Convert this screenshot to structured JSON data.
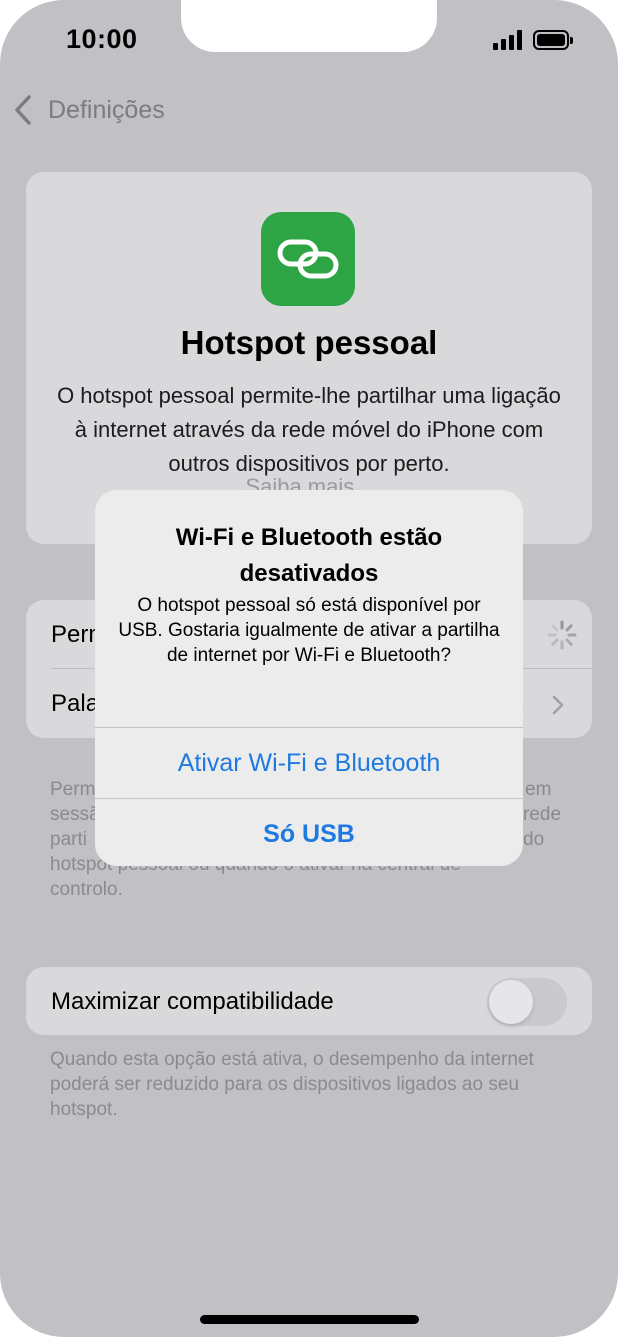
{
  "status_bar": {
    "time": "10:00"
  },
  "nav": {
    "back_label": "Definições"
  },
  "hero": {
    "title": "Hotspot pessoal",
    "description": "O hotspot pessoal permite-lhe partilhar uma ligação à internet através da rede móvel do iPhone com outros dispositivos por perto.",
    "learn_more": "Saiba mais..."
  },
  "settings": {
    "rows": [
      {
        "label": "Perm"
      },
      {
        "label": "Pala",
        "value": ".."
      }
    ],
    "footer_fragments": [
      "Perm",
      "sessã",
      "parti",
      "hotspot pessoal ou quando o ativar na central de",
      "controlo.",
      "em",
      "rede",
      "do"
    ]
  },
  "compat": {
    "label": "Maximizar compatibilidade",
    "enabled": false,
    "footer": "Quando esta opção está ativa, o desempenho da internet poderá ser reduzido para os dispositivos ligados ao seu hotspot."
  },
  "alert": {
    "title": "Wi-Fi e Bluetooth estão desativados",
    "message": "O hotspot pessoal só está disponível por USB. Gostaria igualmente de ativar a partilha de internet por Wi-Fi e Bluetooth?",
    "buttons": [
      {
        "label": "Ativar Wi-Fi e Bluetooth"
      },
      {
        "label": "Só USB"
      }
    ]
  },
  "colors": {
    "accent": "#1e7ae0",
    "app_icon": "#2da545",
    "dim_background": "#c1c1c5"
  }
}
